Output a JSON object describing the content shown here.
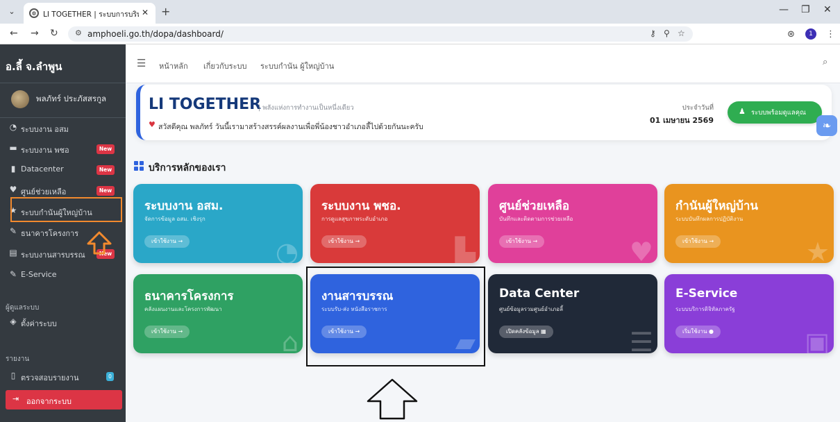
{
  "browser": {
    "tab_title": "LI TOGETHER | ระบบการบริหารงาน",
    "url": "amphoeli.go.th/dopa/dashboard/",
    "profile_initial": "1"
  },
  "sidebar": {
    "brand": "อ.ลี้ จ.ลำพูน",
    "user_name": "พลภัทร์ ประภัสสรกูล",
    "items": [
      {
        "label": "ระบบงาน อสม",
        "icon": "gauge-icon",
        "badge": ""
      },
      {
        "label": "ระบบงาน พชอ",
        "icon": "bed-icon",
        "badge": "New"
      },
      {
        "label": "Datacenter",
        "icon": "file-icon",
        "badge": "New"
      },
      {
        "label": "ศูนย์ช่วยเหลือ",
        "icon": "heart-icon",
        "badge": "New"
      },
      {
        "label": "ระบบกำนันผู้ใหญ่บ้าน",
        "icon": "star-icon",
        "badge": ""
      },
      {
        "label": "ธนาคารโครงการ",
        "icon": "edit-icon",
        "badge": ""
      },
      {
        "label": "ระบบงานสารบรรณ",
        "icon": "id-card-icon",
        "badge": "New"
      },
      {
        "label": "E-Service",
        "icon": "edit-icon",
        "badge": ""
      }
    ],
    "admin_header": "ผู้ดูแลระบบ",
    "settings_label": "ตั้งค่าระบบ",
    "reports_header": "รายงาน",
    "report_label": "ตรวจสอบรายงาน",
    "report_count": "0",
    "logout_label": "ออกจากระบบ"
  },
  "topnav": {
    "links": [
      "หน้าหลัก",
      "เกี่ยวกับระบบ",
      "ระบบกำนัน ผู้ใหญ่บ้าน"
    ]
  },
  "hero": {
    "title": "LI TOGETHER",
    "tagline": "| พลังแห่งการทำงานเป็นหนึ่งเดียว",
    "greeting": "สวัสดีคุณ พลภัทร์ วันนี้เรามาสร้างสรรค์ผลงานเพื่อพี่น้องชาวอำเภอลี้ไปด้วยกันนะครับ",
    "date_label": "ประจำวันที่",
    "date": "01 เมษายน 2569",
    "button_label": "ระบบพร้อมดูแลคุณ"
  },
  "section_title": "บริการหลักของเรา",
  "cards": [
    {
      "title": "ระบบงาน อสม.",
      "subtitle": "จัดการข้อมูล อสม. เชิงรุก",
      "button": "เข้าใช้งาน →",
      "color": "#2aa7c8"
    },
    {
      "title": "ระบบงาน พชอ.",
      "subtitle": "การดูแลสุขภาพระดับอำเภอ",
      "button": "เข้าใช้งาน →",
      "color": "#d93a3a"
    },
    {
      "title": "ศูนย์ช่วยเหลือ",
      "subtitle": "บันทึกและติดตามการช่วยเหลือ",
      "button": "เข้าใช้งาน →",
      "color": "#e0409a"
    },
    {
      "title": "กำนันผู้ใหญ่บ้าน",
      "subtitle": "ระบบบันทึกผลการปฏิบัติงาน",
      "button": "เข้าใช้งาน →",
      "color": "#e9941f"
    },
    {
      "title": "ธนาคารโครงการ",
      "subtitle": "คลังแผนงานและโครงการพัฒนา",
      "button": "เข้าใช้งาน →",
      "color": "#2fa163"
    },
    {
      "title": "งานสารบรรณ",
      "subtitle": "ระบบรับ-ส่ง หนังสือราชการ",
      "button": "เข้าใช้งาน →",
      "color": "#2f63de"
    },
    {
      "title": "Data Center",
      "subtitle": "ศูนย์ข้อมูลรวมศูนย์อำเภอลี้",
      "button": "เปิดคลังข้อมูล ▦",
      "color": "#202938"
    },
    {
      "title": "E-Service",
      "subtitle": "ระบบบริการดิจิทัลภาครัฐ",
      "button": "เริ่มใช้งาน ●",
      "color": "#8a3ed8"
    }
  ]
}
